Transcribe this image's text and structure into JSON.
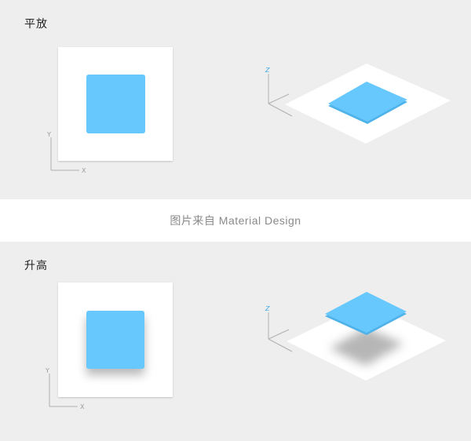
{
  "sections": {
    "flat": {
      "title": "平放"
    },
    "raised": {
      "title": "升高"
    }
  },
  "caption": "图片来自 Material Design",
  "axes": {
    "x": "X",
    "y": "Y",
    "z": "Z"
  },
  "colors": {
    "panel_bg": "#eeeeee",
    "card_bg": "#ffffff",
    "blue": "#66c8fd",
    "blue_edge": "#4fb3ea",
    "axis_line": "#b0b0b0",
    "axis_z": "#3aa8e8",
    "shadow": "#9e9e9e"
  }
}
